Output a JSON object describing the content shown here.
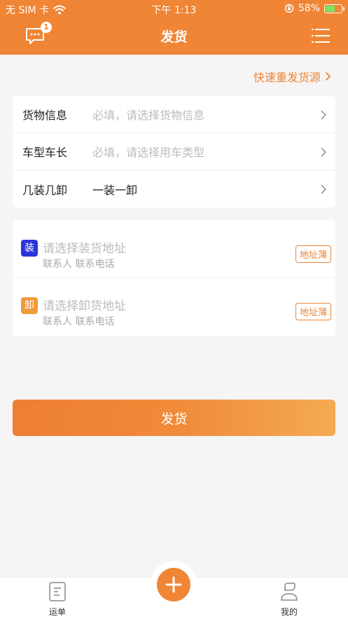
{
  "status_bar": {
    "carrier": "无 SIM 卡",
    "time": "下午 1:13",
    "battery_percent_text": "58%",
    "battery_level": 0.58
  },
  "header": {
    "title": "发货",
    "message_badge_count": "1",
    "accent_color": "#ef8535"
  },
  "quick_repost": {
    "label": "快速重发货源"
  },
  "cargo_form": {
    "rows": [
      {
        "label": "货物信息",
        "value": "必填，请选择货物信息"
      },
      {
        "label": "车型车长",
        "value": "必填，请选择用车类型"
      },
      {
        "label": "几装几卸",
        "value": "一装一卸"
      }
    ]
  },
  "addresses": {
    "load": {
      "badge": "装",
      "placeholder": "请选择装货地址",
      "contact": "联系人 联系电话",
      "book_label": "地址薄",
      "badge_color": "#2a35d8"
    },
    "unload": {
      "badge": "卸",
      "placeholder": "请选择卸货地址",
      "contact": "联系人 联系电话",
      "book_label": "地址薄",
      "badge_color": "#ef9b3c"
    }
  },
  "submit": {
    "label": "发货"
  },
  "tabbar": {
    "items": [
      {
        "label": "运单",
        "icon": "document-icon"
      },
      {
        "label": "我的",
        "icon": "user-icon"
      }
    ],
    "center_icon": "plus-icon"
  }
}
